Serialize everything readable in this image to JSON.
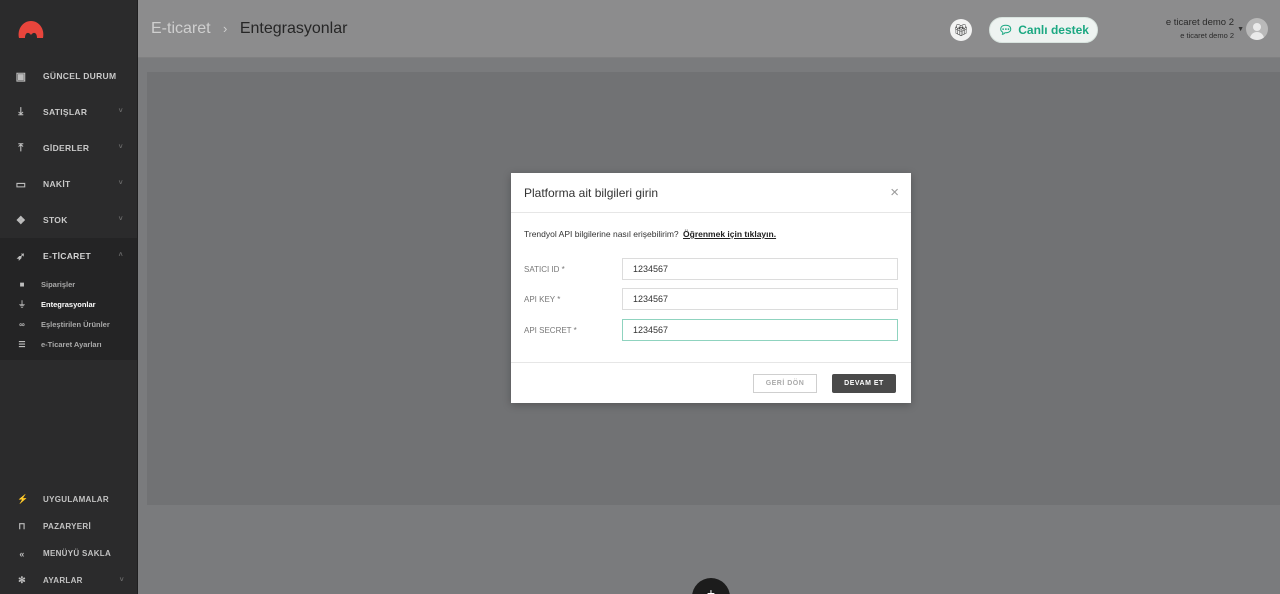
{
  "sidebar": {
    "items": [
      {
        "label": "GÜNCEL DURUM",
        "icon": "dashboard-icon"
      },
      {
        "label": "SATIŞLAR",
        "icon": "download-box-icon"
      },
      {
        "label": "GİDERLER",
        "icon": "upload-box-icon"
      },
      {
        "label": "NAKİT",
        "icon": "cash-icon"
      },
      {
        "label": "STOK",
        "icon": "cubes-icon"
      },
      {
        "label": "E-TİCARET",
        "icon": "rocket-icon"
      }
    ],
    "ecommerce_sub": [
      {
        "label": "Siparişler",
        "icon": "cart-icon"
      },
      {
        "label": "Entegrasyonlar",
        "icon": "plug-icon"
      },
      {
        "label": "Eşleştirilen Ürünler",
        "icon": "link-icon"
      },
      {
        "label": "e-Ticaret Ayarları",
        "icon": "sliders-icon"
      }
    ],
    "bottom": [
      {
        "label": "UYGULAMALAR",
        "icon": "plug-icon"
      },
      {
        "label": "PAZARYERİ",
        "icon": "cart-icon"
      },
      {
        "label": "MENÜYÜ SAKLA",
        "icon": "collapse-icon"
      },
      {
        "label": "AYARLAR",
        "icon": "gear-icon"
      }
    ]
  },
  "header": {
    "breadcrumb_parent": "E-ticaret",
    "breadcrumb_separator": "›",
    "breadcrumb_current": "Entegrasyonlar",
    "support_label": "Canlı destek",
    "user_name": "e ticaret demo 2",
    "user_company": "e ticaret demo 2"
  },
  "modal": {
    "title": "Platforma ait bilgileri girin",
    "info_text": "Trendyol API bilgilerine nasıl erişebilirim?",
    "info_link": "Öğrenmek için tıklayın.",
    "fields": [
      {
        "label": "SATICI ID *",
        "value": "1234567"
      },
      {
        "label": "API KEY *",
        "value": "1234567"
      },
      {
        "label": "API SECRET *",
        "value": "1234567"
      }
    ],
    "back_label": "GERİ DÖN",
    "next_label": "DEVAM ET"
  },
  "colors": {
    "accent": "#1ba882",
    "sidebar_bg": "#2b2b2c",
    "logo": "#e8453c"
  }
}
